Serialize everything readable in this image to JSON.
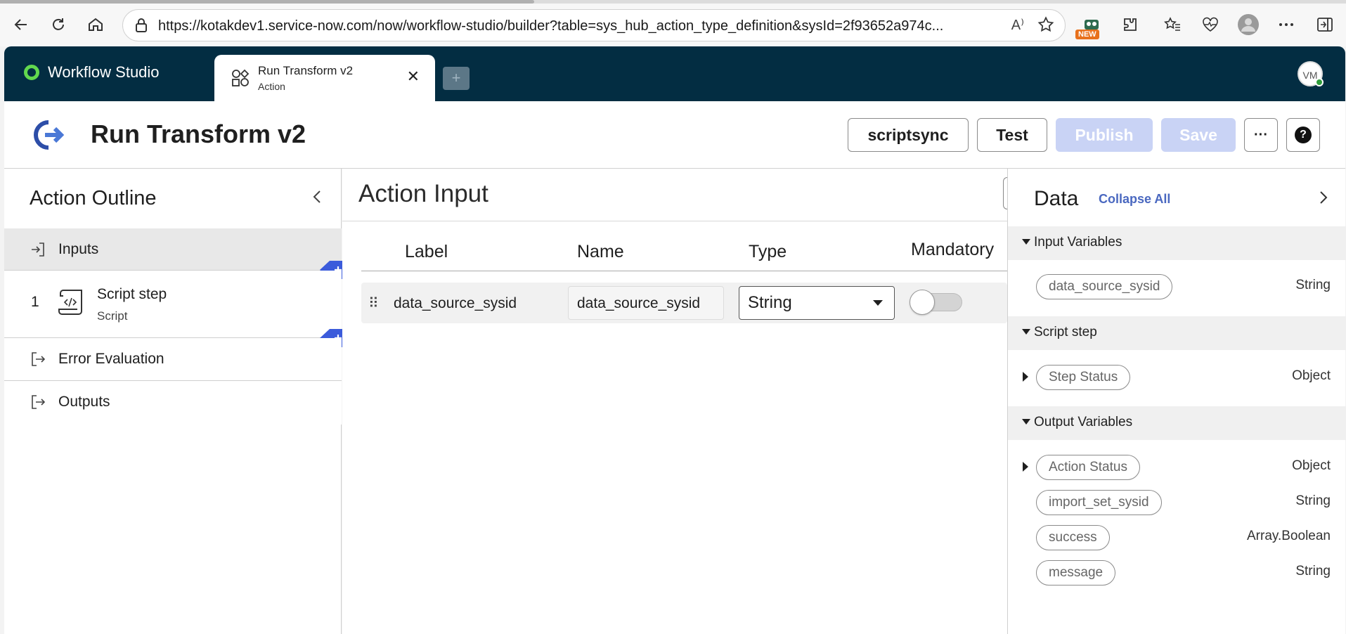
{
  "browser": {
    "url": "https://kotakdev1.service-now.com/now/workflow-studio/builder?table=sys_hub_action_type_definition&sysId=2f93652a974c...",
    "read_aloud_label": "A⁾",
    "new_badge": "NEW"
  },
  "app": {
    "brand": "Workflow Studio",
    "tab": {
      "title": "Run Transform v2",
      "subtitle": "Action"
    },
    "avatar": "VM"
  },
  "header": {
    "title": "Run Transform v2",
    "buttons": {
      "scriptsync": "scriptsync",
      "test": "Test",
      "publish": "Publish",
      "save": "Save",
      "more": "···",
      "help": "?"
    }
  },
  "outline": {
    "title": "Action Outline",
    "items": [
      {
        "label": "Inputs"
      },
      {
        "number": "1",
        "label": "Script step",
        "sub": "Script"
      },
      {
        "label": "Error Evaluation"
      },
      {
        "label": "Outputs"
      }
    ]
  },
  "action_input": {
    "title": "Action Input",
    "columns": [
      "Label",
      "Name",
      "Type",
      "Mandatory"
    ],
    "rows": [
      {
        "label": "data_source_sysid",
        "name": "data_source_sysid",
        "type": "String",
        "mandatory": false
      }
    ]
  },
  "data_panel": {
    "title": "Data",
    "collapse_all": "Collapse All",
    "sections": [
      {
        "name": "Input Variables",
        "vars": [
          {
            "name": "data_source_sysid",
            "type": "String"
          }
        ]
      },
      {
        "name": "Script step",
        "vars": [
          {
            "name": "Step Status",
            "type": "Object"
          }
        ]
      },
      {
        "name": "Output Variables",
        "vars": [
          {
            "name": "Action Status",
            "type": "Object"
          },
          {
            "name": "import_set_sysid",
            "type": "String"
          },
          {
            "name": "success",
            "type": "Array.Boolean"
          },
          {
            "name": "message",
            "type": "String"
          }
        ]
      }
    ]
  },
  "colors": {
    "appbar": "#032d42",
    "accent": "#3b5bdb",
    "disabled_button": "#c9d3f5",
    "brand_green": "#62d84e"
  }
}
